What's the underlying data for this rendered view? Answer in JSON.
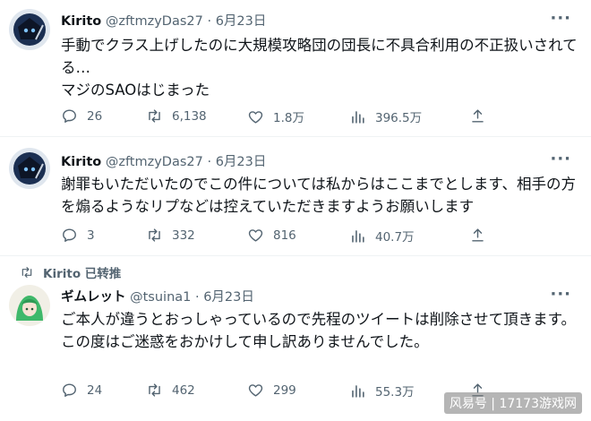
{
  "tweets": [
    {
      "name": "Kirito",
      "handle": "@zftmzyDas27",
      "sep": " · ",
      "date": "6月23日",
      "text": [
        "手動でクラス上げしたのに大規模攻略団の団長に不具合利用の不正扱いされてる…",
        "マジのSAOはじまった"
      ],
      "replies": "26",
      "retweets": "6,138",
      "likes": "1.8万",
      "views": "396.5万"
    },
    {
      "name": "Kirito",
      "handle": "@zftmzyDas27",
      "sep": " · ",
      "date": "6月23日",
      "text": [
        "謝罪もいただいたのでこの件については私からはここまでとします、相手の方を煽るようなリプなどは控えていただきますようお願いします"
      ],
      "replies": "3",
      "retweets": "332",
      "likes": "816",
      "views": "40.7万"
    },
    {
      "retweeted_by": "Kirito 已转推",
      "name": "ギムレット",
      "handle": "@tsuina1",
      "sep": " · ",
      "date": "6月23日",
      "text": [
        "ご本人が違うとおっしゃっているので先程のツイートは削除させて頂きます。",
        "この度はご迷惑をおかけして申し訳ありませんでした。"
      ],
      "replies": "24",
      "retweets": "462",
      "likes": "299",
      "views": "55.3万"
    }
  ],
  "more_label": "···",
  "watermark": "风易号 | 17173游戏网",
  "icons": [
    "reply-icon",
    "retweet-icon",
    "like-icon",
    "views-icon",
    "share-icon",
    "more-icon"
  ],
  "colors": {
    "text": "#0f1419",
    "secondary": "#536471",
    "divider": "#eff3f4"
  }
}
